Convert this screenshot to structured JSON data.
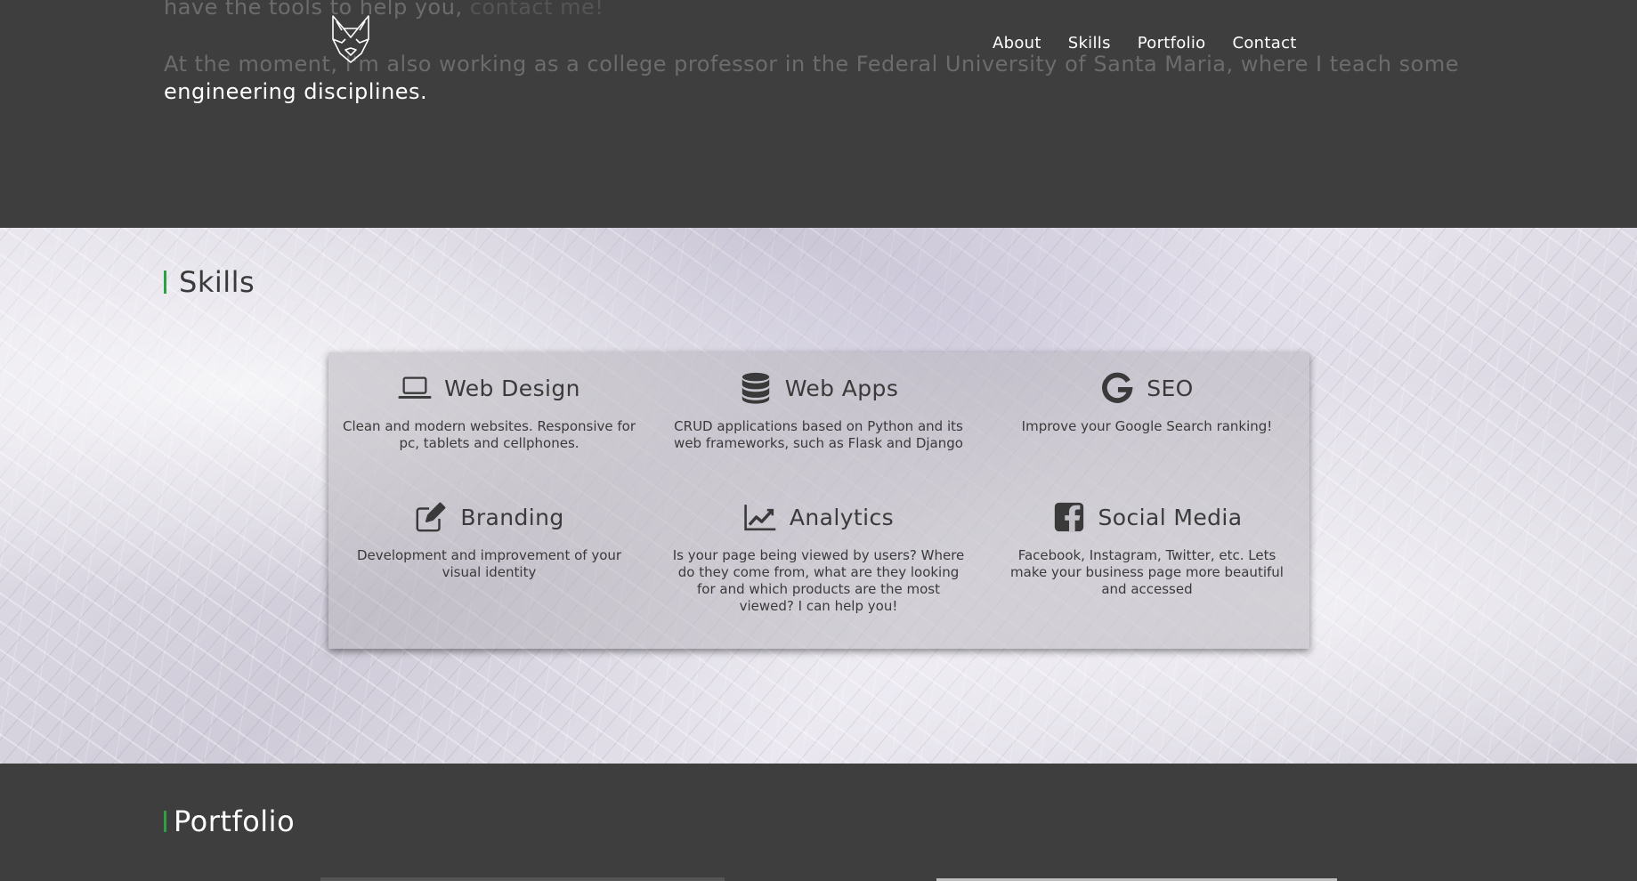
{
  "about": {
    "line1_text": "have the tools to help you,",
    "line1_link": "contact me!",
    "line2": "At the moment, I'm also working as a college professor in the Federal University of Santa Maria, where I teach some",
    "line3": "engineering disciplines."
  },
  "nav": {
    "logo": "fox-logo-icon",
    "items": [
      "About",
      "Skills",
      "Portfolio",
      "Contact"
    ]
  },
  "skills": {
    "title": "Skills",
    "accent_color": "#2ea043",
    "items": [
      {
        "icon": "laptop-icon",
        "name": "Web Design",
        "desc": "Clean and modern websites. Responsive for pc, tablets and cellphones."
      },
      {
        "icon": "database-icon",
        "name": "Web Apps",
        "desc": "CRUD applications based on Python and its web frameworks, such as Flask and Django"
      },
      {
        "icon": "google-icon",
        "name": "SEO",
        "desc": "Improve your Google Search ranking!"
      },
      {
        "icon": "edit-icon",
        "name": "Branding",
        "desc": "Development and improvement of your visual identity"
      },
      {
        "icon": "line-chart-icon",
        "name": "Analytics",
        "desc": "Is your page being viewed by users? Where do they come from, what are they looking for and which products are the most viewed? I can help you!"
      },
      {
        "icon": "facebook-icon",
        "name": "Social Media",
        "desc": "Facebook, Instagram, Twitter, etc. Lets make your business page more beautiful and accessed"
      }
    ]
  },
  "portfolio": {
    "title": "Portfolio"
  }
}
